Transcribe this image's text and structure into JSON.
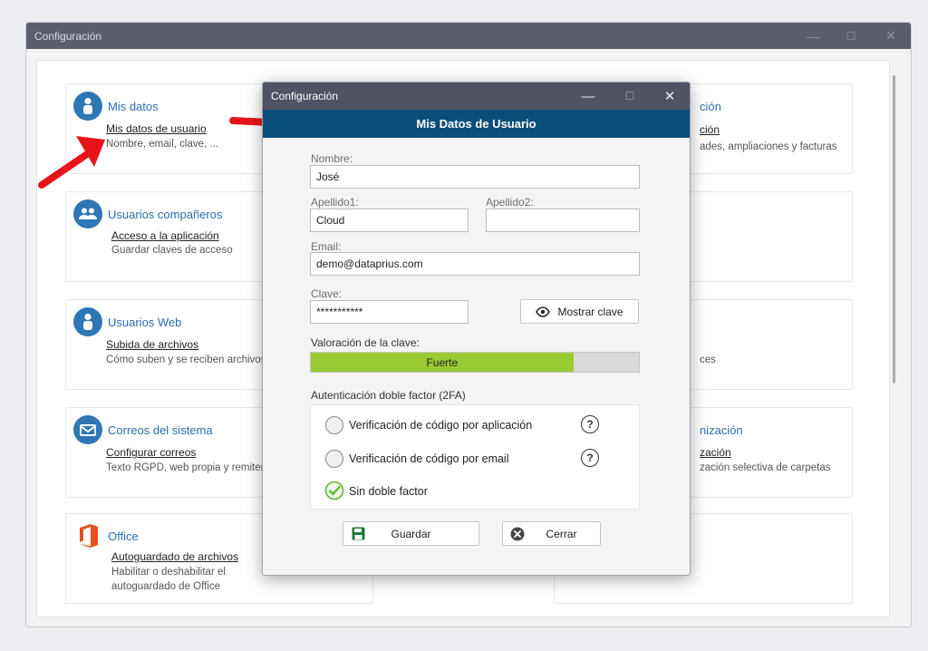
{
  "main_window": {
    "title": "Configuración",
    "controls": {
      "minimize": "—",
      "maximize": "☐",
      "close": "✕"
    }
  },
  "cards": {
    "mis_datos": {
      "title": "Mis datos",
      "link": "Mis datos de usuario",
      "desc": "Nombre, email, clave, ..."
    },
    "usuarios_companeros": {
      "title": "Usuarios compañeros",
      "link": "Acceso a la aplicación",
      "desc": "Guardar claves de acceso"
    },
    "usuarios_web": {
      "title": "Usuarios Web",
      "link": "Subida de archivos",
      "desc": "Cómo suben y se reciben archivos"
    },
    "correos": {
      "title": "Correos del sistema",
      "link": "Configurar correos",
      "desc": "Texto RGPD, web propia y remiten"
    },
    "office": {
      "title": "Office",
      "link": "Autoguardado de archivos",
      "desc_line1": "Habilitar o deshabilitar el",
      "desc_line2": "autoguardado de Office"
    },
    "right_top": {
      "title": "ción",
      "link": "ción",
      "desc": "ades, ampliaciones y facturas"
    },
    "right_mid": {
      "desc": "ces"
    },
    "right_sync": {
      "title": "nización",
      "link": "zación",
      "desc": "zación selectiva de carpetas"
    }
  },
  "dialog": {
    "title": "Configuración",
    "controls": {
      "minimize": "—",
      "maximize": "☐",
      "close": "✕"
    },
    "header": "Mis Datos de Usuario",
    "nombre_label": "Nombre:",
    "nombre_value": "José",
    "apellido1_label": "Apellido1:",
    "apellido1_value": "Cloud",
    "apellido2_label": "Apellido2:",
    "apellido2_value": "",
    "email_label": "Email:",
    "email_value": "demo@dataprius.com",
    "clave_label": "Clave:",
    "clave_value": "***********",
    "show_password_label": "Mostrar clave",
    "strength_label": "Valoración de la clave:",
    "strength_value": "Fuerte",
    "strength_level": 0.8,
    "twofa_label": "Autenticación doble factor (2FA)",
    "twofa_options": [
      {
        "label": "Verificación de código por aplicación",
        "selected": false
      },
      {
        "label": "Verificación de código por email",
        "selected": false
      },
      {
        "label": "Sin doble factor",
        "selected": true
      }
    ],
    "help_glyph": "?",
    "save_label": "Guardar",
    "close_label": "Cerrar"
  },
  "colors": {
    "title_bar": "#5a5e6e",
    "dialog_header": "#0a4f7a",
    "accent_blue": "#2f76b5",
    "strength_green": "#99cc33",
    "check_green": "#5cb82e",
    "office_orange": "#e8501c",
    "arrow_red": "#e8141b"
  }
}
